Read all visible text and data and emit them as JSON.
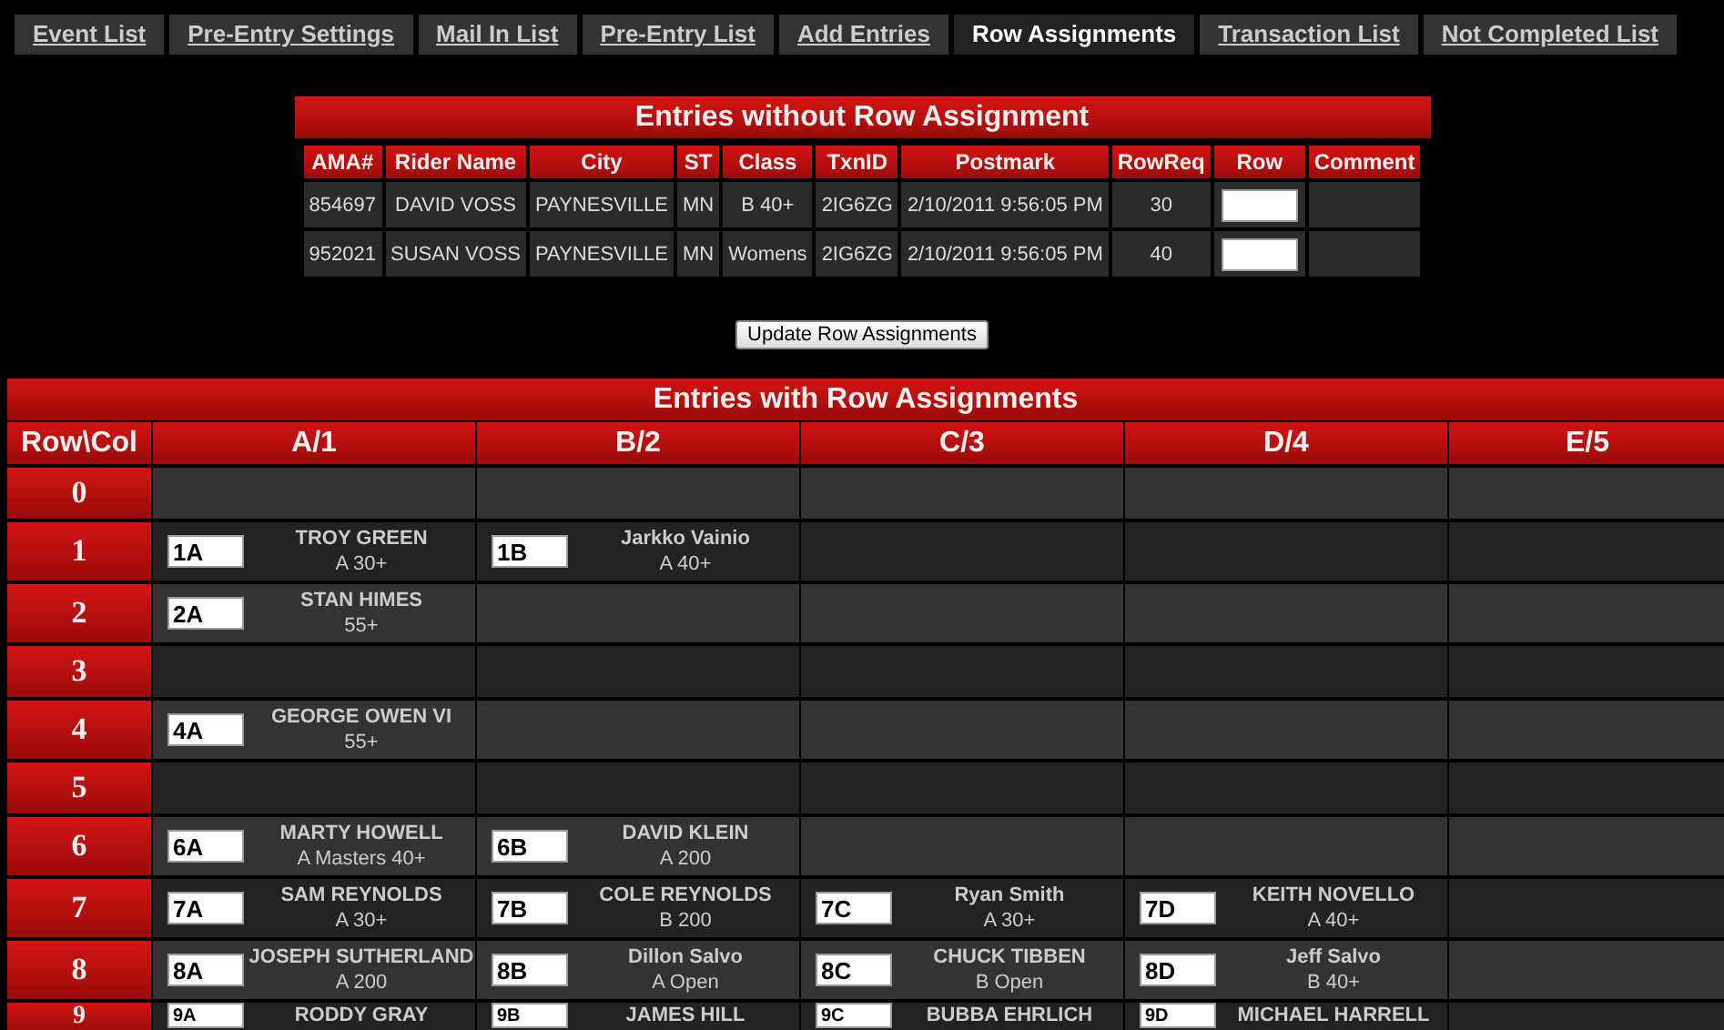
{
  "tabs": [
    {
      "label": "Event List",
      "selected": false
    },
    {
      "label": "Pre-Entry Settings",
      "selected": false
    },
    {
      "label": "Mail In List",
      "selected": false
    },
    {
      "label": "Pre-Entry List",
      "selected": false
    },
    {
      "label": "Add Entries",
      "selected": false
    },
    {
      "label": "Row Assignments",
      "selected": true
    },
    {
      "label": "Transaction List",
      "selected": false
    },
    {
      "label": "Not Completed List",
      "selected": false
    }
  ],
  "unassigned": {
    "title": "Entries without Row Assignment",
    "columns": [
      "AMA#",
      "Rider Name",
      "City",
      "ST",
      "Class",
      "TxnID",
      "Postmark",
      "RowReq",
      "Row",
      "Comment"
    ],
    "rows": [
      {
        "ama": "854697",
        "rider": "DAVID VOSS",
        "city": "PAYNESVILLE",
        "st": "MN",
        "class": "B 40+",
        "txn": "2IG6ZG",
        "postmark": "2/10/2011 9:56:05 PM",
        "rowreq": "30"
      },
      {
        "ama": "952021",
        "rider": "SUSAN VOSS",
        "city": "PAYNESVILLE",
        "st": "MN",
        "class": "Womens",
        "txn": "2IG6ZG",
        "postmark": "2/10/2011 9:56:05 PM",
        "rowreq": "40"
      }
    ]
  },
  "update_button": "Update Row Assignments",
  "assigned": {
    "title": "Entries with Row Assignments",
    "corner": "Row\\Col",
    "columns": [
      "A/1",
      "B/2",
      "C/3",
      "D/4",
      "E/5"
    ],
    "rows": [
      {
        "row": "0",
        "cells": [
          {
            "kind": "empty"
          },
          {
            "kind": "empty"
          },
          {
            "kind": "empty"
          },
          {
            "kind": "empty"
          },
          {
            "kind": "empty"
          }
        ]
      },
      {
        "row": "1",
        "cells": [
          {
            "kind": "entry",
            "seat": "1A",
            "name": "TROY GREEN",
            "class": "A 30+"
          },
          {
            "kind": "entry",
            "seat": "1B",
            "name": "Jarkko Vainio",
            "class": "A 40+"
          },
          {
            "kind": "empty"
          },
          {
            "kind": "empty"
          },
          {
            "kind": "empty"
          }
        ]
      },
      {
        "row": "2",
        "cells": [
          {
            "kind": "entry",
            "seat": "2A",
            "name": "STAN HIMES",
            "class": "55+"
          },
          {
            "kind": "empty"
          },
          {
            "kind": "empty"
          },
          {
            "kind": "empty"
          },
          {
            "kind": "empty"
          }
        ]
      },
      {
        "row": "3",
        "cells": [
          {
            "kind": "empty"
          },
          {
            "kind": "empty"
          },
          {
            "kind": "empty"
          },
          {
            "kind": "empty"
          },
          {
            "kind": "empty"
          }
        ]
      },
      {
        "row": "4",
        "cells": [
          {
            "kind": "entry",
            "seat": "4A",
            "name": "GEORGE OWEN VI",
            "class": "55+"
          },
          {
            "kind": "empty"
          },
          {
            "kind": "empty"
          },
          {
            "kind": "empty"
          },
          {
            "kind": "empty"
          }
        ]
      },
      {
        "row": "5",
        "cells": [
          {
            "kind": "empty"
          },
          {
            "kind": "empty"
          },
          {
            "kind": "empty"
          },
          {
            "kind": "empty"
          },
          {
            "kind": "empty"
          }
        ]
      },
      {
        "row": "6",
        "cells": [
          {
            "kind": "entry",
            "seat": "6A",
            "name": "MARTY HOWELL",
            "class": "A Masters 40+"
          },
          {
            "kind": "entry",
            "seat": "6B",
            "name": "DAVID KLEIN",
            "class": "A 200"
          },
          {
            "kind": "empty"
          },
          {
            "kind": "empty"
          },
          {
            "kind": "empty"
          }
        ]
      },
      {
        "row": "7",
        "cells": [
          {
            "kind": "entry",
            "seat": "7A",
            "name": "SAM REYNOLDS",
            "class": "A 30+"
          },
          {
            "kind": "entry",
            "seat": "7B",
            "name": "COLE REYNOLDS",
            "class": "B 200"
          },
          {
            "kind": "entry",
            "seat": "7C",
            "name": "Ryan Smith",
            "class": "A 30+"
          },
          {
            "kind": "entry",
            "seat": "7D",
            "name": "KEITH NOVELLO",
            "class": "A 40+"
          },
          {
            "kind": "empty"
          }
        ]
      },
      {
        "row": "8",
        "cells": [
          {
            "kind": "entry",
            "seat": "8A",
            "name": "JOSEPH SUTHERLAND",
            "class": "A 200"
          },
          {
            "kind": "entry",
            "seat": "8B",
            "name": "Dillon Salvo",
            "class": "A Open"
          },
          {
            "kind": "entry",
            "seat": "8C",
            "name": "CHUCK TIBBEN",
            "class": "B Open"
          },
          {
            "kind": "entry",
            "seat": "8D",
            "name": "Jeff Salvo",
            "class": "B 40+"
          },
          {
            "kind": "empty"
          }
        ]
      },
      {
        "row": "9",
        "cells": [
          {
            "kind": "entry",
            "seat": "9A",
            "name": "RODDY GRAY"
          },
          {
            "kind": "entry",
            "seat": "9B",
            "name": "JAMES HILL"
          },
          {
            "kind": "entry",
            "seat": "9C",
            "name": "BUBBA EHRLICH"
          },
          {
            "kind": "entry",
            "seat": "9D",
            "name": "MICHAEL HARRELL"
          },
          {
            "kind": "empty"
          }
        ]
      }
    ]
  }
}
